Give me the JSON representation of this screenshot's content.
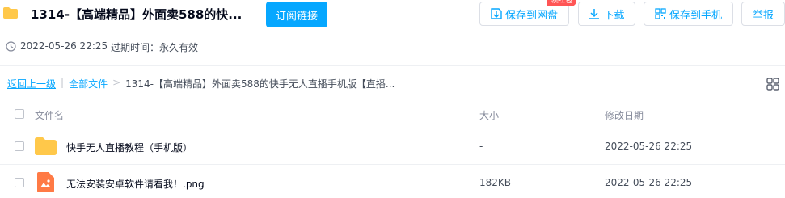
{
  "header": {
    "title": "1314-【高端精品】外面卖588的快...",
    "subscribe_label": "订阅链接",
    "save_disk_label": "保存到网盘",
    "save_badge": "领红包",
    "download_label": "下载",
    "save_phone_label": "保存到手机",
    "report_label": "举报"
  },
  "meta": {
    "date": "2022-05-26 22:25",
    "expire": "过期时间：永久有效"
  },
  "breadcrumb": {
    "back": "返回上一级",
    "sep1": "|",
    "all_files": "全部文件",
    "sep2": ">",
    "current": "1314-【高端精品】外面卖588的快手无人直播手机版【直播..."
  },
  "table": {
    "headers": {
      "name": "文件名",
      "size": "大小",
      "date": "修改日期"
    },
    "rows": [
      {
        "name": "快手无人直播教程（手机版）",
        "size": "-",
        "date": "2022-05-26 22:25",
        "type": "folder"
      },
      {
        "name": "无法安装安卓软件请看我！.png",
        "size": "182KB",
        "date": "2022-05-26 22:25",
        "type": "image"
      }
    ]
  },
  "colors": {
    "accent": "#06a7ff",
    "folder": "#ffc84a",
    "image_file": "#ff7a45"
  },
  "icons": [
    "folder-icon",
    "clock-icon",
    "save-icon",
    "download-icon",
    "qr-icon",
    "grid-view-icon",
    "image-file-icon"
  ]
}
